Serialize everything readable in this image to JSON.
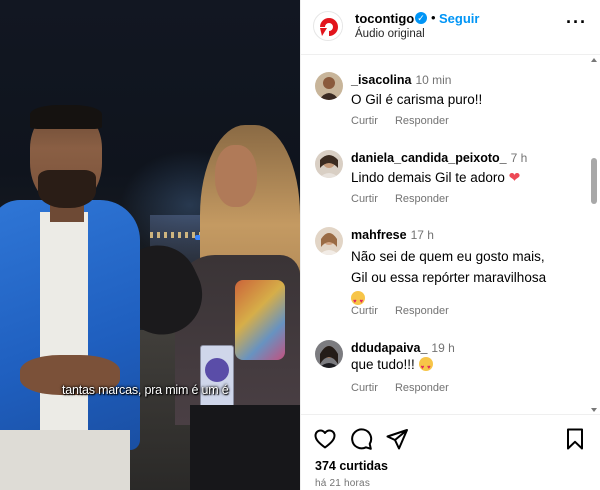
{
  "post": {
    "username": "tocontigo",
    "verified_mark": "✓",
    "separator": "•",
    "follow_label": "Seguir",
    "audio_label": "Áudio original",
    "more_label": "···",
    "caption_overlay": "tantas marcas, pra mim é um é",
    "likes_text": "374 curtidas",
    "time_ago": "há 21 horas"
  },
  "comments": [
    {
      "user": "_isacolina",
      "time": "10 min",
      "text_lines": [
        "O Gil é carisma puro!!"
      ],
      "emoji": "",
      "like_label": "Curtir",
      "reply_label": "Responder"
    },
    {
      "user": "daniela_candida_peixoto_",
      "time": "7 h",
      "text_lines": [
        "Lindo demais Gil te adoro"
      ],
      "emoji": "heart",
      "like_label": "Curtir",
      "reply_label": "Responder"
    },
    {
      "user": "mahfrese",
      "time": "17 h",
      "text_lines": [
        "Não sei de quem eu gosto mais,",
        "Gil ou essa repórter maravilhosa"
      ],
      "emoji": "heart-eyes-face",
      "like_label": "Curtir",
      "reply_label": "Responder"
    },
    {
      "user": "ddudapaiva_",
      "time": "19 h",
      "text_lines": [
        "que tudo!!!"
      ],
      "emoji": "heart-eyes-face",
      "like_label": "Curtir",
      "reply_label": "Responder"
    }
  ],
  "icons": {
    "like": "heart-icon",
    "comment": "comment-icon",
    "share": "share-icon",
    "save": "bookmark-icon",
    "more": "more-options-icon",
    "verified": "verified-badge-icon"
  },
  "colors": {
    "accent_blue": "#0095f6",
    "verified_blue": "#0095f6",
    "brand_red": "#e2141c",
    "secondary_text": "#737373",
    "heart_red": "#ed4956",
    "jacket_blue": "#2f76d6"
  }
}
